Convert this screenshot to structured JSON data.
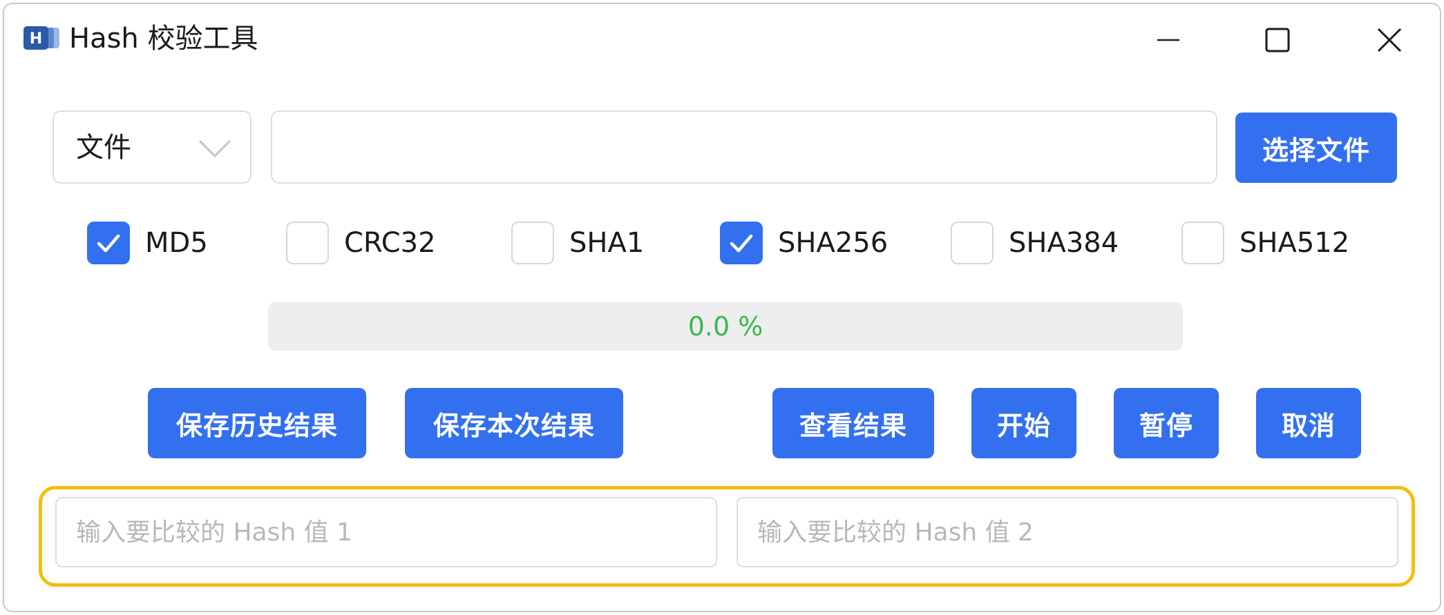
{
  "window": {
    "title": "Hash 校验工具",
    "icon": "app-logo-icon",
    "controls": [
      "minimize-icon",
      "maximize-icon",
      "close-icon"
    ]
  },
  "source": {
    "mode_selected": "文件",
    "path_value": "",
    "choose_file_label": "选择文件"
  },
  "algorithms": [
    {
      "label": "MD5",
      "checked": true
    },
    {
      "label": "CRC32",
      "checked": false
    },
    {
      "label": "SHA1",
      "checked": false
    },
    {
      "label": "SHA256",
      "checked": true
    },
    {
      "label": "SHA384",
      "checked": false
    },
    {
      "label": "SHA512",
      "checked": false
    }
  ],
  "progress": {
    "percent": 0.0,
    "text": "0.0 %"
  },
  "actions": {
    "save_history": "保存历史结果",
    "save_current": "保存本次结果",
    "view_results": "查看结果",
    "start": "开始",
    "pause": "暂停",
    "cancel": "取消"
  },
  "compare": {
    "hash1_placeholder": "输入要比较的 Hash 值 1",
    "hash2_placeholder": "输入要比较的 Hash 值 2"
  },
  "colors": {
    "primary": "#3370f0",
    "progress_text": "#3cb850",
    "highlight_border": "#f5bd10"
  }
}
